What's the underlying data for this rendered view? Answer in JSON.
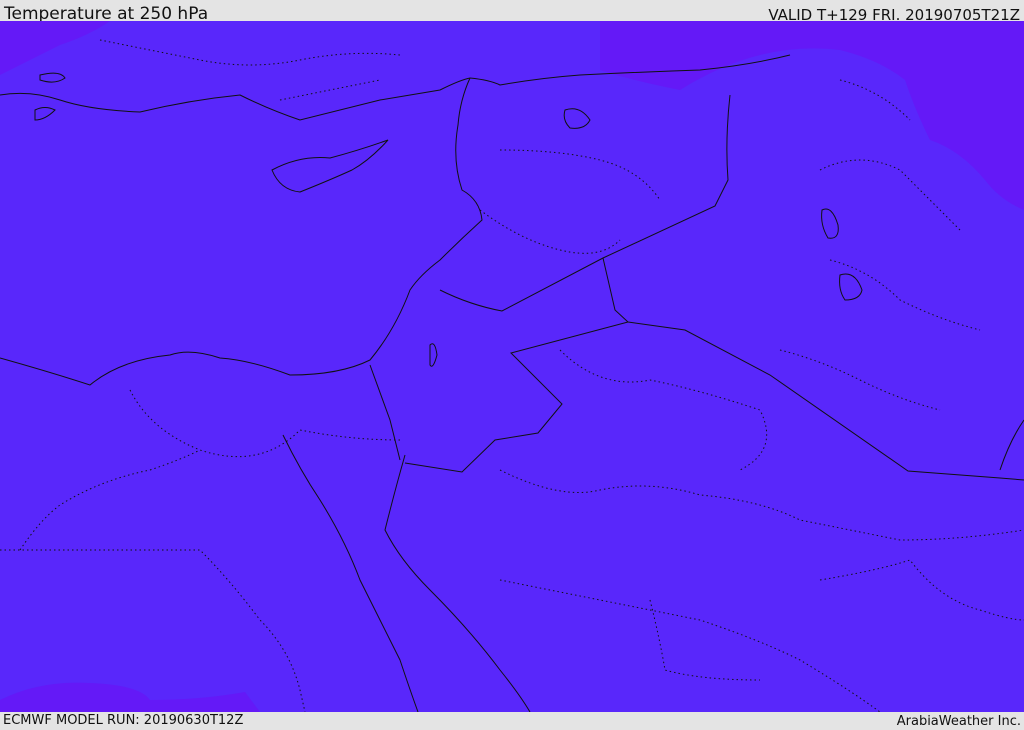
{
  "header": {
    "title": "Temperature at 250 hPa",
    "valid": "VALID T+129 FRI. 20190705T21Z"
  },
  "footer": {
    "model_run": "ECMWF MODEL RUN: 20190630T12Z",
    "credit": "ArabiaWeather Inc."
  },
  "colors": {
    "field_main": "#5927fb",
    "field_cold": "#6419f7",
    "coastline": "#111111",
    "background": "#e4e4e4"
  }
}
